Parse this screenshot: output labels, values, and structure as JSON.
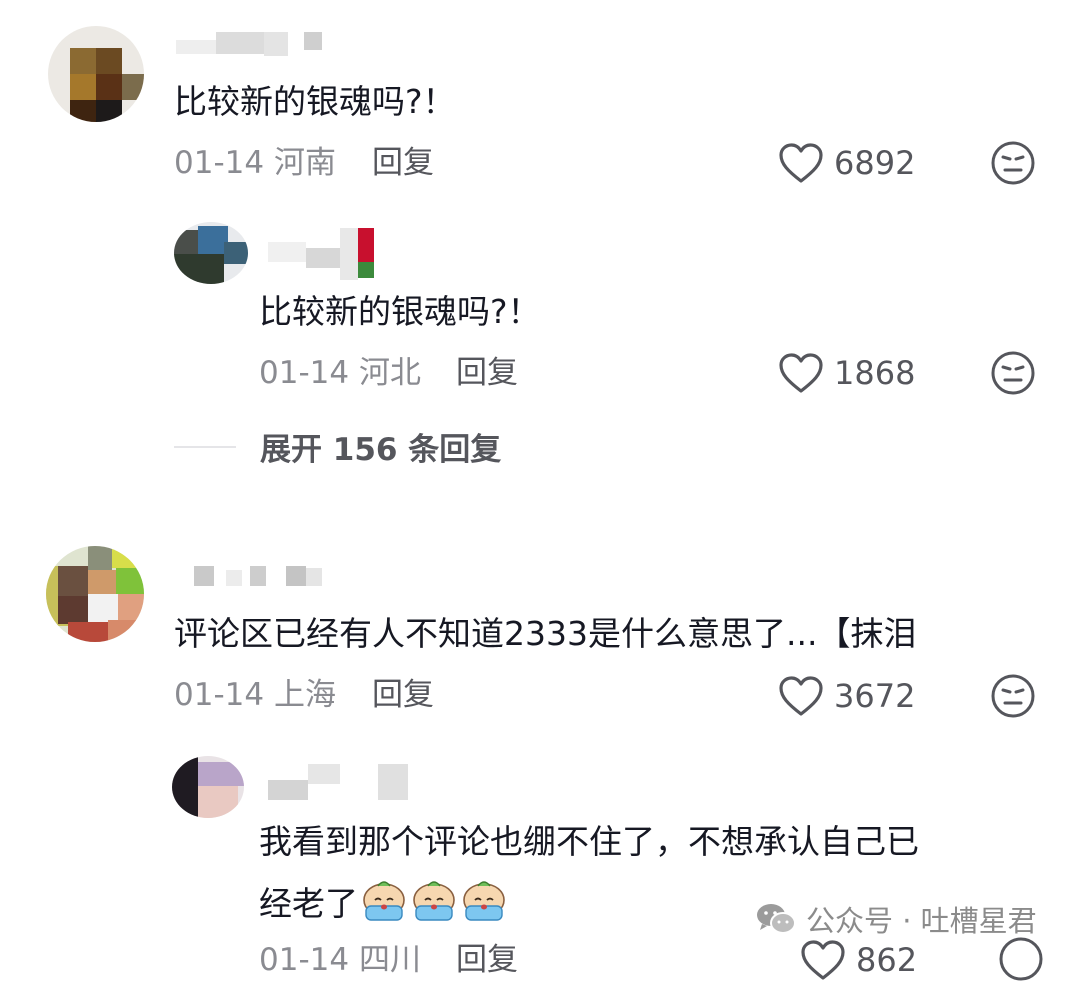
{
  "comments": [
    {
      "text": "比较新的银魂吗?！",
      "date": "01-14",
      "location": "河南",
      "reply_label": "回复",
      "likes": "6892",
      "reply": {
        "text": "比较新的银魂吗?！",
        "date": "01-14",
        "location": "河北",
        "reply_label": "回复",
        "likes": "1868"
      },
      "expand_label": "展开 156 条回复"
    },
    {
      "text": "评论区已经有人不知道2333是什么意思了...【抹泪",
      "date": "01-14",
      "location": "上海",
      "reply_label": "回复",
      "likes": "3672",
      "reply": {
        "text_line1": "我看到那个评论也绷不住了，不想承认自己已",
        "text_line2": "经老了",
        "emoji": "crying-emoji",
        "date": "01-14",
        "location": "四川",
        "reply_label": "回复",
        "likes": "862"
      }
    }
  ],
  "watermark": {
    "icon": "wechat-icon",
    "text": "公众号 · 吐槽星君"
  },
  "colors": {
    "primary_text": "#161823",
    "secondary_text": "#8a8b91",
    "icon": "#55565c"
  }
}
